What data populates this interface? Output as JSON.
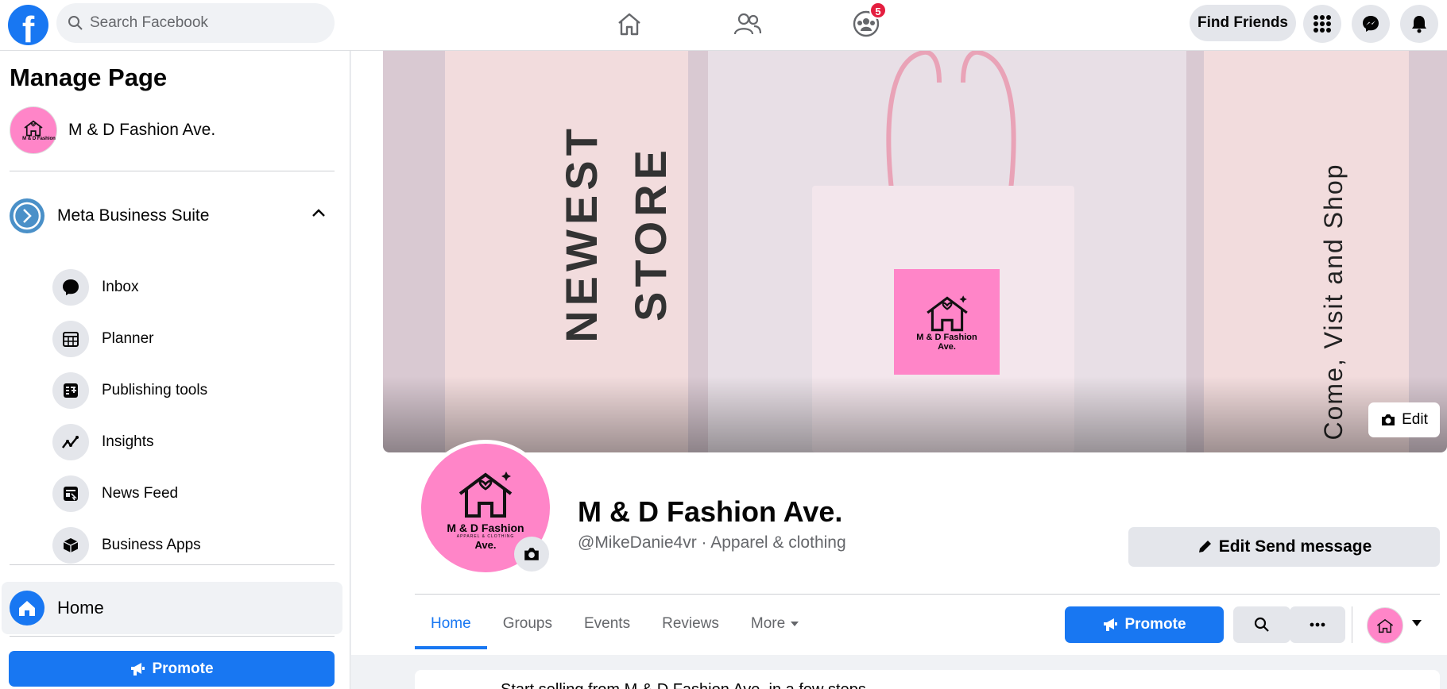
{
  "topbar": {
    "search_placeholder": "Search Facebook",
    "groups_badge": "5",
    "find_friends": "Find Friends"
  },
  "sidebar": {
    "title": "Manage Page",
    "page_name": "M & D Fashion Ave.",
    "mbs_label": "Meta Business Suite",
    "tools": [
      {
        "label": "Inbox",
        "icon": "chat-bubble-icon"
      },
      {
        "label": "Planner",
        "icon": "calendar-icon"
      },
      {
        "label": "Publishing tools",
        "icon": "publishing-tools-icon"
      },
      {
        "label": "Insights",
        "icon": "insights-icon"
      },
      {
        "label": "News Feed",
        "icon": "news-feed-icon"
      },
      {
        "label": "Business Apps",
        "icon": "cube-icon"
      }
    ],
    "home_label": "Home",
    "promote_label": "Promote"
  },
  "cover": {
    "text_newest": "NEWEST",
    "text_store": "STORE",
    "text_come": "Come, Visit and Shop",
    "edit_label": "Edit"
  },
  "logo": {
    "name": "M & D Fashion",
    "tagline": "APPAREL & CLOTHING",
    "suffix": "Ave."
  },
  "profile": {
    "name": "M & D Fashion Ave.",
    "subtitle": "@MikeDanie4vr · Apparel & clothing",
    "edit_send_label": "Edit Send message"
  },
  "tabs": [
    {
      "label": "Home",
      "active": true
    },
    {
      "label": "Groups",
      "active": false
    },
    {
      "label": "Events",
      "active": false
    },
    {
      "label": "Reviews",
      "active": false
    },
    {
      "label": "More",
      "active": false
    }
  ],
  "actions": {
    "promote_label": "Promote"
  },
  "feed": {
    "post_text": "Start selling from M & D Fashion Ave. in a few steps"
  },
  "colors": {
    "brand": "#1877f2",
    "logo_pink": "#ff85c8",
    "badge_red": "#e41e3f"
  }
}
